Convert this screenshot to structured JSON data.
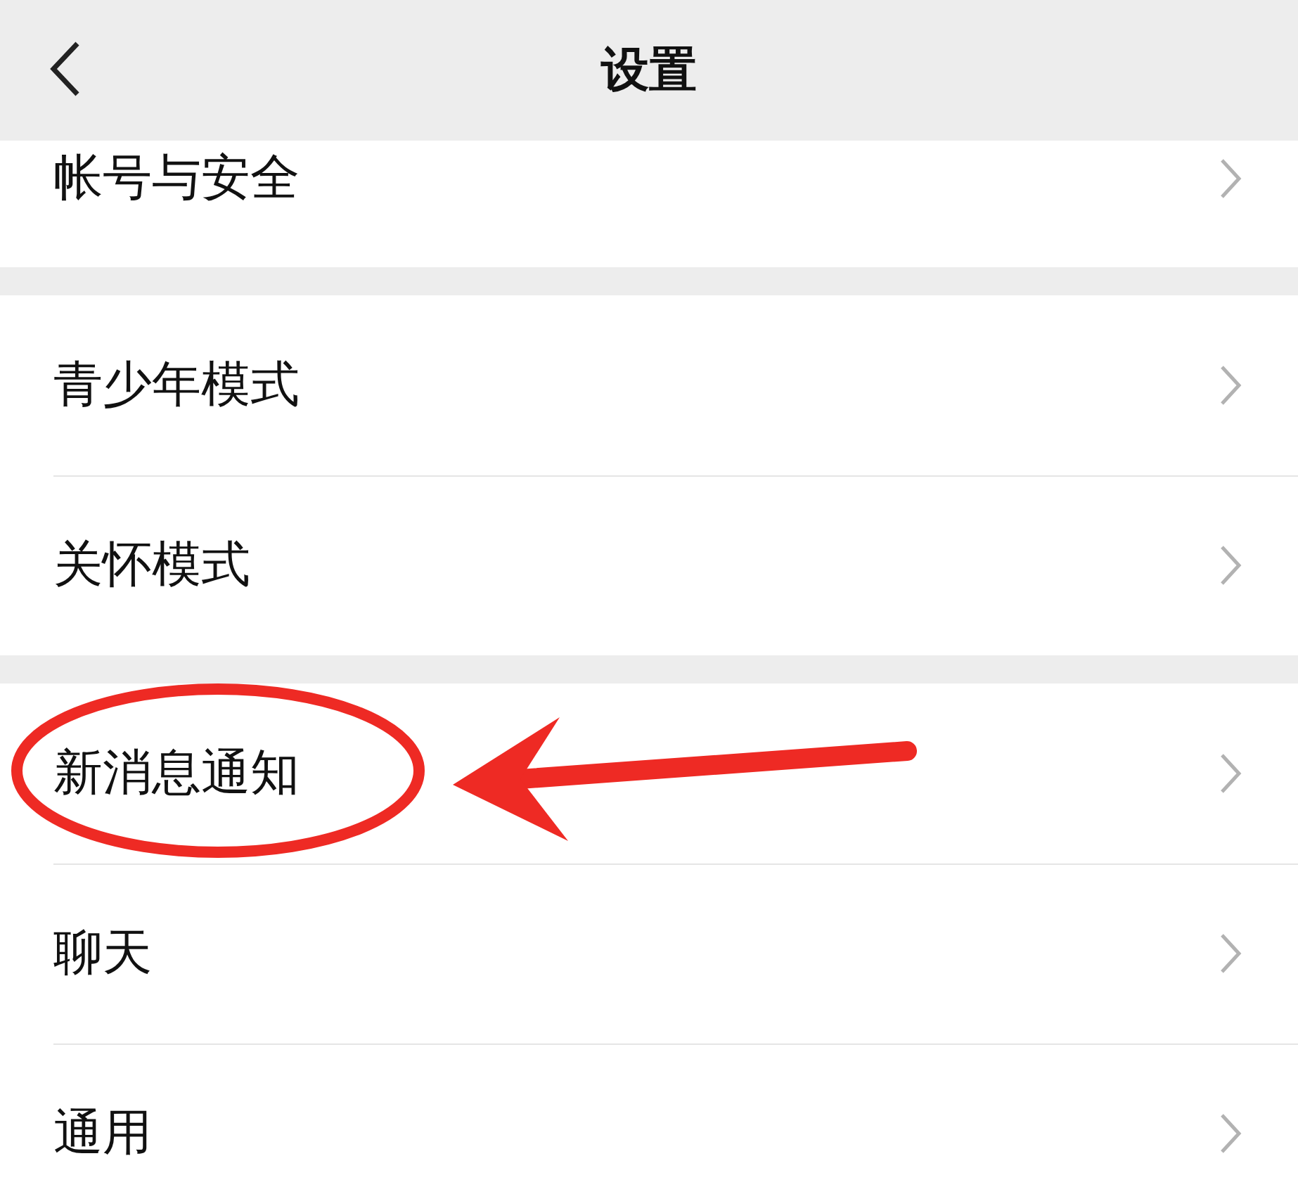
{
  "header": {
    "title": "设置"
  },
  "sections": [
    {
      "items": [
        {
          "label": "帐号与安全",
          "highlighted": false
        }
      ]
    },
    {
      "items": [
        {
          "label": "青少年模式",
          "highlighted": false
        },
        {
          "label": "关怀模式",
          "highlighted": false
        }
      ]
    },
    {
      "items": [
        {
          "label": "新消息通知",
          "highlighted": true
        },
        {
          "label": "聊天",
          "highlighted": false
        },
        {
          "label": "通用",
          "highlighted": false
        }
      ]
    }
  ]
}
